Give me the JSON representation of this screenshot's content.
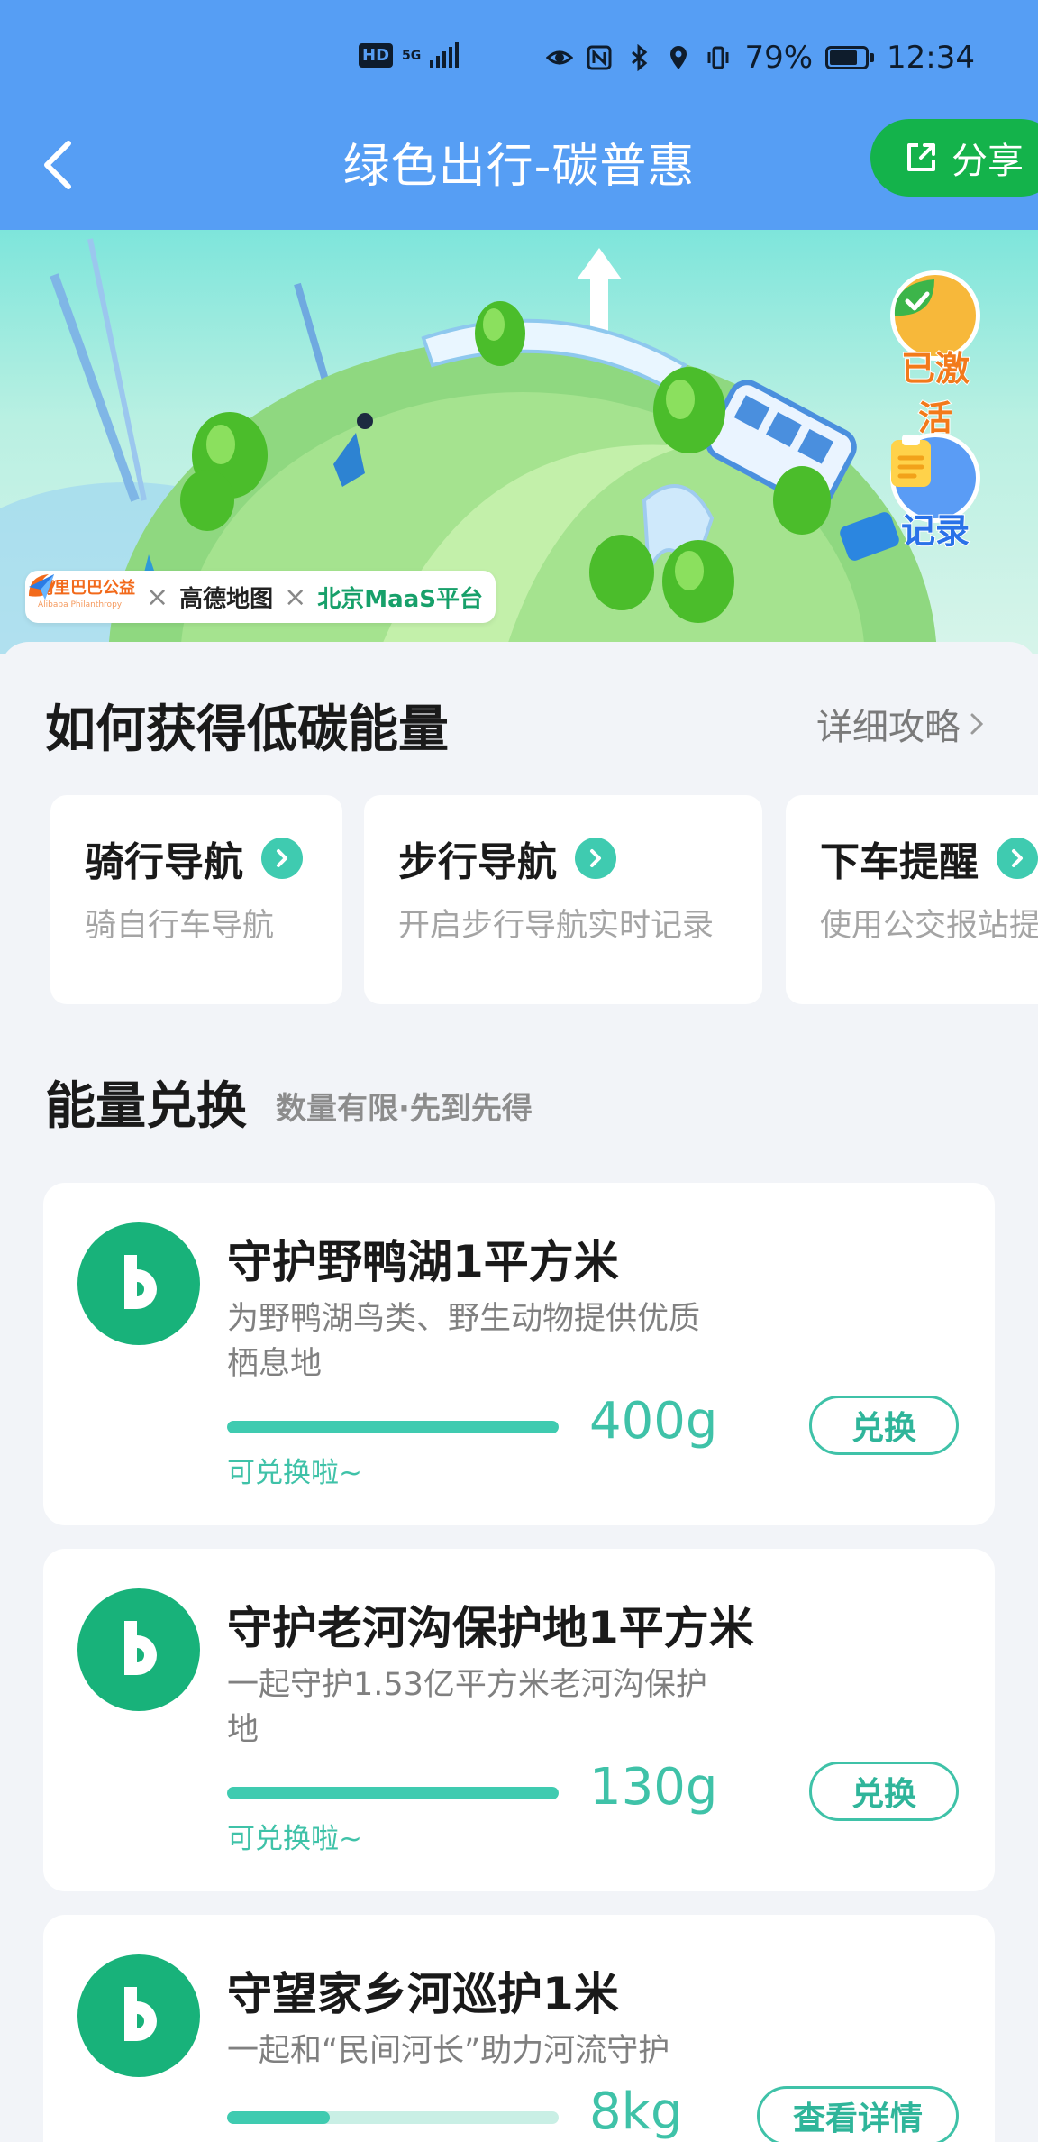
{
  "status_bar": {
    "hd": "HD",
    "network": "5G",
    "battery": "79%",
    "time": "12:34"
  },
  "header": {
    "title": "绿色出行-碳普惠",
    "share_label": "分享"
  },
  "banner": {
    "partners": {
      "alibaba_cn": "阿里巴巴公益",
      "alibaba_en": "Alibaba Philanthropy",
      "amap": "高德地图",
      "maas": "北京MaaS平台"
    },
    "activated_label": "已激活",
    "records_label": "记录"
  },
  "how_to": {
    "title": "如何获得低碳能量",
    "guide_link": "详细攻略",
    "methods": [
      {
        "name": "骑行导航",
        "desc": "骑自行车导航"
      },
      {
        "name": "步行导航",
        "desc": "开启步行导航实时记录"
      },
      {
        "name": "下车提醒",
        "desc": "使用公交报站提醒"
      }
    ]
  },
  "exchange": {
    "title": "能量兑换",
    "subtitle": "数量有限·先到先得",
    "items": [
      {
        "name": "守护野鸭湖1平方米",
        "desc": "为野鸭湖鸟类、野生动物提供优质栖息地",
        "cost": "400g",
        "hint": "可兑换啦~",
        "button": "兑换",
        "progress": 1.0
      },
      {
        "name": "守护老河沟保护地1平方米",
        "desc": "一起守护1.53亿平方米老河沟保护地",
        "cost": "130g",
        "hint": "可兑换啦~",
        "button": "兑换",
        "progress": 1.0
      },
      {
        "name": "守望家乡河巡护1米",
        "desc": "一起和“民间河长”助力河流守护",
        "cost": "8kg",
        "hint": "",
        "button": "查看详情",
        "progress": 0.31
      }
    ]
  },
  "colors": {
    "header_blue": "#569ef4",
    "share_green": "#14b34b",
    "accent_teal": "#3fcbb0",
    "icon_green": "#18b27a"
  }
}
